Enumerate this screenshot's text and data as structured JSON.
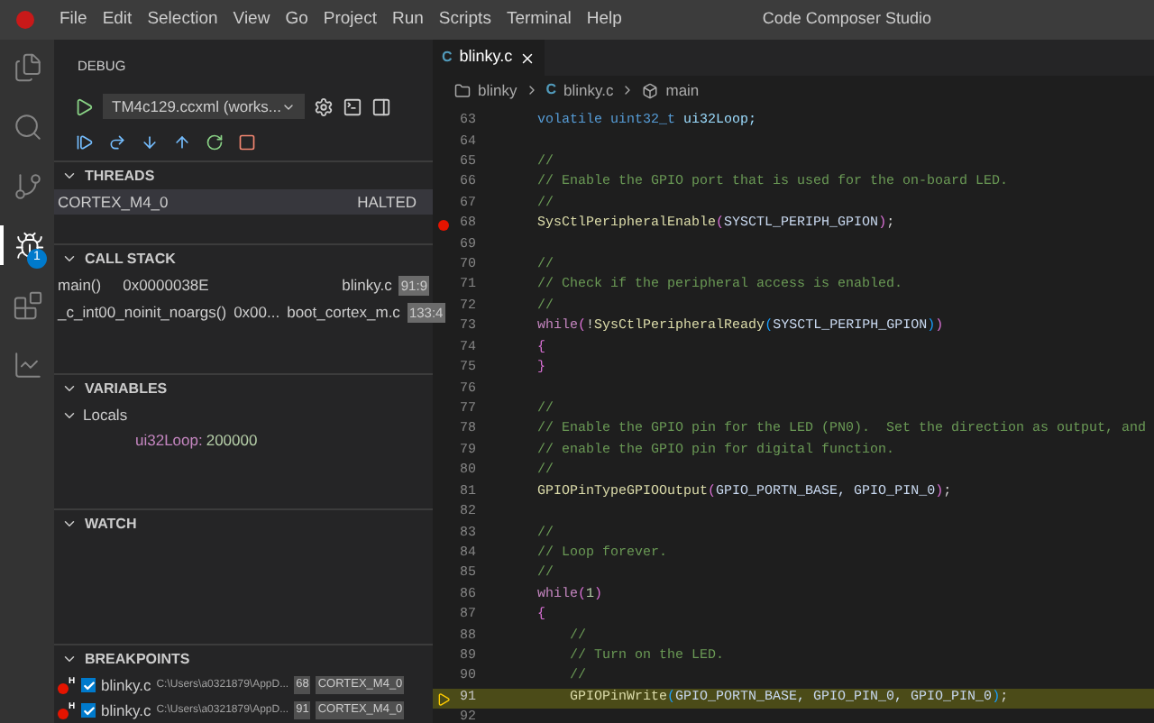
{
  "app": {
    "menu": [
      "File",
      "Edit",
      "Selection",
      "View",
      "Go",
      "Project",
      "Run",
      "Scripts",
      "Terminal",
      "Help"
    ],
    "title": "Code Composer Studio"
  },
  "activity_bar": [
    {
      "kind": "files",
      "selected": false
    },
    {
      "kind": "search",
      "selected": false
    },
    {
      "kind": "branch",
      "selected": false
    },
    {
      "kind": "debug",
      "selected": true,
      "badge": "1"
    },
    {
      "kind": "blocks",
      "selected": false
    },
    {
      "kind": "chart",
      "selected": false
    }
  ],
  "sidebar": {
    "title": "DEBUG",
    "config": "TM4c129.ccxml (works...",
    "threads": {
      "title": "THREADS",
      "expanded": true,
      "rows": [
        {
          "name": "CORTEX_M4_0",
          "state": "HALTED",
          "selected": true
        }
      ]
    },
    "call_stack": {
      "title": "CALL STACK",
      "expanded": true,
      "rows": [
        {
          "function": "main()",
          "address": "0x0000038E",
          "file": "blinky.c",
          "position": "91:9"
        },
        {
          "function": "_c_int00_noinit_noargs()",
          "address": "0x00...",
          "file": "boot_cortex_m.c",
          "position": "133:4"
        }
      ]
    },
    "variables": {
      "title": "VARIABLES",
      "expanded": true,
      "scope": {
        "label": "Locals",
        "expanded": true
      },
      "items": [
        {
          "name": "ui32Loop:",
          "value": "200000"
        }
      ]
    },
    "watch": {
      "title": "WATCH",
      "expanded": true
    },
    "breakpoints": {
      "title": "BREAKPOINTS",
      "expanded": true,
      "rows": [
        {
          "marker": "H",
          "checked": true,
          "file": "blinky.c",
          "path": "C:\\Users\\a0321879\\AppD...",
          "line": "68",
          "core": "CORTEX_M4_0"
        },
        {
          "marker": "H",
          "checked": true,
          "file": "blinky.c",
          "path": "C:\\Users\\a0321879\\AppD...",
          "line": "91",
          "core": "CORTEX_M4_0"
        }
      ]
    }
  },
  "editor": {
    "tabs": [
      {
        "label": "blinky.c",
        "icon_letter": "C",
        "selected": true
      }
    ],
    "breadcrumb": [
      {
        "kind": "folder",
        "label": "blinky"
      },
      {
        "kind": "c",
        "icon_letter": "C",
        "label": "blinky.c"
      },
      {
        "kind": "symbol",
        "label": "main"
      }
    ],
    "lines": [
      {
        "number": "63",
        "breakpoint": false,
        "current": false,
        "tokens": [
          {
            "kind": "kw",
            "text": "    volatile "
          },
          {
            "kind": "kw",
            "text": "uint32_t"
          },
          {
            "kind": "var",
            "text": " ui32Loop;"
          }
        ]
      },
      {
        "number": "64",
        "breakpoint": false,
        "current": false
      },
      {
        "number": "65",
        "breakpoint": false,
        "current": false,
        "tokens": [
          {
            "kind": "cm",
            "text": "    //"
          }
        ]
      },
      {
        "number": "66",
        "breakpoint": false,
        "current": false,
        "tokens": [
          {
            "kind": "cm",
            "text": "    // Enable the GPIO port that is used for the on-board LED."
          }
        ]
      },
      {
        "number": "67",
        "breakpoint": false,
        "current": false,
        "tokens": [
          {
            "kind": "cm",
            "text": "    //"
          }
        ]
      },
      {
        "number": "68",
        "breakpoint": true,
        "current": false,
        "tokens": [
          {
            "kind": "fn",
            "text": "    SysCtlPeripheralEnable"
          },
          {
            "kind": "p2",
            "text": "("
          },
          {
            "kind": "macro",
            "text": "SYSCTL_PERIPH_GPION"
          },
          {
            "kind": "p2",
            "text": ")"
          },
          {
            "kind": "pl",
            "text": ";"
          }
        ]
      },
      {
        "number": "69",
        "breakpoint": false,
        "current": false
      },
      {
        "number": "70",
        "breakpoint": false,
        "current": false,
        "tokens": [
          {
            "kind": "cm",
            "text": "    //"
          }
        ]
      },
      {
        "number": "71",
        "breakpoint": false,
        "current": false,
        "tokens": [
          {
            "kind": "cm",
            "text": "    // Check if the peripheral access is enabled."
          }
        ]
      },
      {
        "number": "72",
        "breakpoint": false,
        "current": false,
        "tokens": [
          {
            "kind": "cm",
            "text": "    //"
          }
        ]
      },
      {
        "number": "73",
        "breakpoint": false,
        "current": false,
        "tokens": [
          {
            "kind": "ctl",
            "text": "    while"
          },
          {
            "kind": "p2",
            "text": "("
          },
          {
            "kind": "pl",
            "text": "!"
          },
          {
            "kind": "fn",
            "text": "SysCtlPeripheralReady"
          },
          {
            "kind": "p3",
            "text": "("
          },
          {
            "kind": "macro",
            "text": "SYSCTL_PERIPH_GPION"
          },
          {
            "kind": "p3",
            "text": ")"
          },
          {
            "kind": "p2",
            "text": ")"
          }
        ]
      },
      {
        "number": "74",
        "breakpoint": false,
        "current": false,
        "tokens": [
          {
            "kind": "p2",
            "text": "    {"
          }
        ]
      },
      {
        "number": "75",
        "breakpoint": false,
        "current": false,
        "tokens": [
          {
            "kind": "p2",
            "text": "    }"
          }
        ]
      },
      {
        "number": "76",
        "breakpoint": false,
        "current": false
      },
      {
        "number": "77",
        "breakpoint": false,
        "current": false,
        "tokens": [
          {
            "kind": "cm",
            "text": "    //"
          }
        ]
      },
      {
        "number": "78",
        "breakpoint": false,
        "current": false,
        "tokens": [
          {
            "kind": "cm",
            "text": "    // Enable the GPIO pin for the LED (PN0).  Set the direction as output, and"
          }
        ]
      },
      {
        "number": "79",
        "breakpoint": false,
        "current": false,
        "tokens": [
          {
            "kind": "cm",
            "text": "    // enable the GPIO pin for digital function."
          }
        ]
      },
      {
        "number": "80",
        "breakpoint": false,
        "current": false,
        "tokens": [
          {
            "kind": "cm",
            "text": "    //"
          }
        ]
      },
      {
        "number": "81",
        "breakpoint": false,
        "current": false,
        "tokens": [
          {
            "kind": "fn",
            "text": "    GPIOPinTypeGPIOOutput"
          },
          {
            "kind": "p2",
            "text": "("
          },
          {
            "kind": "macro",
            "text": "GPIO_PORTN_BASE, GPIO_PIN_0"
          },
          {
            "kind": "p2",
            "text": ")"
          },
          {
            "kind": "pl",
            "text": ";"
          }
        ]
      },
      {
        "number": "82",
        "breakpoint": false,
        "current": false
      },
      {
        "number": "83",
        "breakpoint": false,
        "current": false,
        "tokens": [
          {
            "kind": "cm",
            "text": "    //"
          }
        ]
      },
      {
        "number": "84",
        "breakpoint": false,
        "current": false,
        "tokens": [
          {
            "kind": "cm",
            "text": "    // Loop forever."
          }
        ]
      },
      {
        "number": "85",
        "breakpoint": false,
        "current": false,
        "tokens": [
          {
            "kind": "cm",
            "text": "    //"
          }
        ]
      },
      {
        "number": "86",
        "breakpoint": false,
        "current": false,
        "tokens": [
          {
            "kind": "ctl",
            "text": "    while"
          },
          {
            "kind": "p2",
            "text": "("
          },
          {
            "kind": "num",
            "text": "1"
          },
          {
            "kind": "p2",
            "text": ")"
          }
        ]
      },
      {
        "number": "87",
        "breakpoint": false,
        "current": false,
        "tokens": [
          {
            "kind": "p2",
            "text": "    {"
          }
        ]
      },
      {
        "number": "88",
        "breakpoint": false,
        "current": false,
        "tokens": [
          {
            "kind": "cm",
            "text": "        //"
          }
        ]
      },
      {
        "number": "89",
        "breakpoint": false,
        "current": false,
        "tokens": [
          {
            "kind": "cm",
            "text": "        // Turn on the LED."
          }
        ]
      },
      {
        "number": "90",
        "breakpoint": false,
        "current": false,
        "tokens": [
          {
            "kind": "cm",
            "text": "        //"
          }
        ]
      },
      {
        "number": "91",
        "breakpoint": false,
        "current": true,
        "tokens": [
          {
            "kind": "fn",
            "text": "        GPIOPinWrite"
          },
          {
            "kind": "p3",
            "text": "("
          },
          {
            "kind": "macro",
            "text": "GPIO_PORTN_BASE, GPIO_PIN_0, GPIO_PIN_0"
          },
          {
            "kind": "p3",
            "text": ")"
          },
          {
            "kind": "pl",
            "text": ";"
          }
        ]
      },
      {
        "number": "92",
        "breakpoint": false,
        "current": false
      }
    ]
  }
}
